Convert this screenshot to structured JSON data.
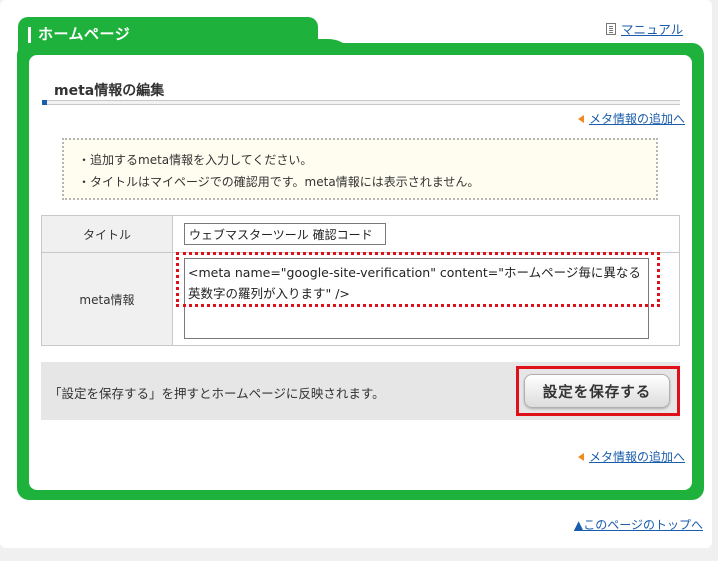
{
  "header": {
    "title": "ホームページ",
    "manual_link": "マニュアル"
  },
  "section": {
    "title": "meta情報の編集"
  },
  "links": {
    "add_meta_top": "メタ情報の追加へ",
    "add_meta_bottom": "メタ情報の追加へ",
    "page_top": "▲このページのトップへ"
  },
  "notice": {
    "lines": [
      "・追加するmeta情報を入力してください。",
      "・タイトルはマイページでの確認用です。meta情報には表示されません。"
    ]
  },
  "form": {
    "title_label": "タイトル",
    "title_value": "ウェブマスターツール 確認コード",
    "meta_label": "meta情報",
    "meta_value": "<meta name=\"google-site-verification\" content=\"ホームページ毎に異なる英数字の羅列が入ります\" />"
  },
  "save": {
    "description": "「設定を保存する」を押すとホームページに反映されます。",
    "button_label": "設定を保存する"
  },
  "colors": {
    "brand_green": "#1eb23c",
    "link_blue": "#1a5dad",
    "highlight_red": "#e0101a",
    "arrow_orange": "#f08a1c"
  }
}
